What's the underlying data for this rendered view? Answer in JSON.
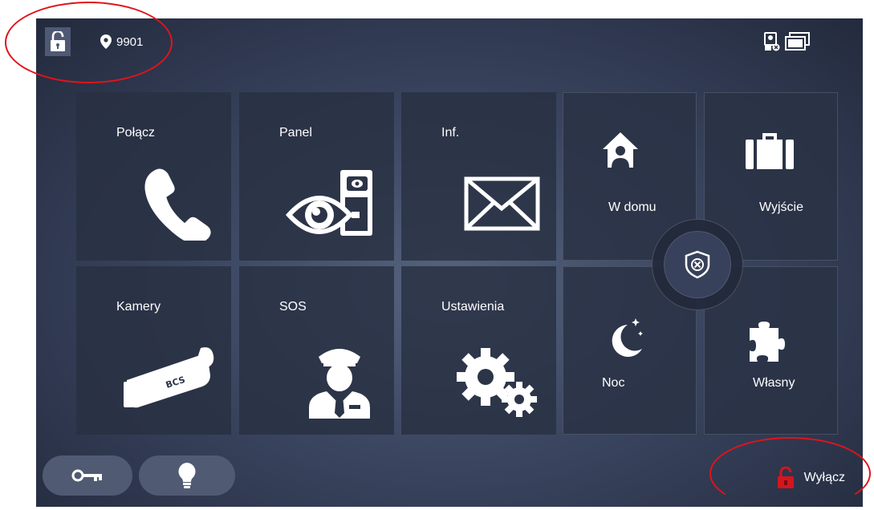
{
  "header": {
    "lock_icon": "unlock-icon",
    "location_icon": "map-pin-icon",
    "room_number": "9901",
    "status_icons": [
      "camera-offline-icon",
      "monitor-stack-icon"
    ]
  },
  "tiles": {
    "call": {
      "label": "Połącz",
      "icon": "phone-handset-icon"
    },
    "panel": {
      "label": "Panel",
      "icon": "eye-door-panel-icon"
    },
    "info": {
      "label": "Inf.",
      "icon": "envelope-icon"
    },
    "cameras": {
      "label": "Kamery",
      "icon": "cctv-camera-icon"
    },
    "sos": {
      "label": "SOS",
      "icon": "security-guard-icon"
    },
    "settings": {
      "label": "Ustawienia",
      "icon": "gears-icon"
    }
  },
  "security": {
    "home": {
      "label": "W domu",
      "icon": "home-person-icon"
    },
    "away": {
      "label": "Wyjście",
      "icon": "briefcase-icon"
    },
    "night": {
      "label": "Noc",
      "icon": "moon-stars-icon"
    },
    "custom": {
      "label": "Własny",
      "icon": "puzzle-icon"
    },
    "center_icon": "shield-x-icon"
  },
  "bottom": {
    "key_button_icon": "key-icon",
    "light_button_icon": "bulb-icon",
    "disarm_label": "Wyłącz",
    "disarm_icon": "red-unlock-icon",
    "disarm_color": "#d4151e"
  },
  "annotation_color": "#e0141b"
}
